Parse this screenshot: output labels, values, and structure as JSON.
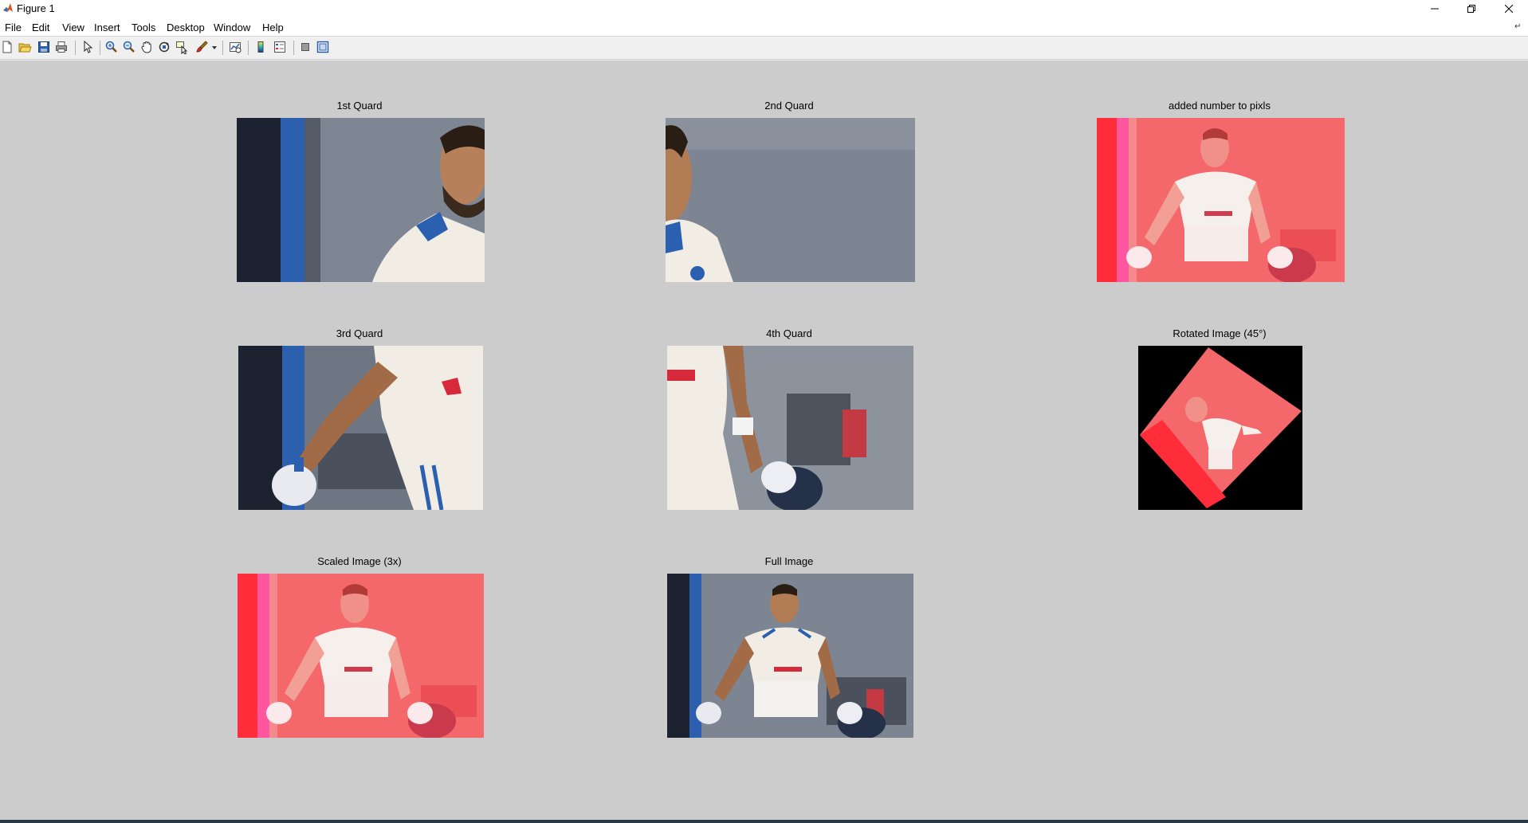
{
  "window": {
    "title": "Figure 1",
    "controls": [
      "minimize-icon",
      "restore-icon",
      "close-icon"
    ]
  },
  "menu": {
    "items": [
      "File",
      "Edit",
      "View",
      "Insert",
      "Tools",
      "Desktop",
      "Window",
      "Help"
    ]
  },
  "toolbar": {
    "icons": [
      "new-figure-icon",
      "open-file-icon",
      "save-icon",
      "print-icon",
      "edit-plot-icon",
      "zoom-in-icon",
      "zoom-out-icon",
      "pan-icon",
      "rotate-3d-icon",
      "data-cursor-icon",
      "brush-icon",
      "brush-dropdown-icon",
      "link-plot-icon",
      "colorbar-icon",
      "legend-icon",
      "hide-plot-tools-icon",
      "show-plot-tools-icon"
    ]
  },
  "subplots": [
    {
      "title": "1st Quard",
      "image": "top-left quadrant of cricket player photo"
    },
    {
      "title": "2nd Quard",
      "image": "top-right quadrant of cricket player photo"
    },
    {
      "title": "added number to pixls",
      "image": "red-tinted brightened full photo"
    },
    {
      "title": "3rd Quard",
      "image": "bottom-left quadrant of cricket player photo"
    },
    {
      "title": "4th Quard",
      "image": "bottom-right quadrant of cricket player photo"
    },
    {
      "title": "Rotated Image (45°)",
      "image": "red-tinted photo rotated 45 degrees on black"
    },
    {
      "title": "Scaled Image (3x)",
      "image": "red-tinted scaled photo"
    },
    {
      "title": "Full Image",
      "image": "original full cricket player photo"
    }
  ],
  "colors": {
    "figure_background": "#cccccc",
    "red_tint": "#ff5a5f",
    "jersey": "#f2ede4",
    "backdrop": "#7d8592"
  }
}
